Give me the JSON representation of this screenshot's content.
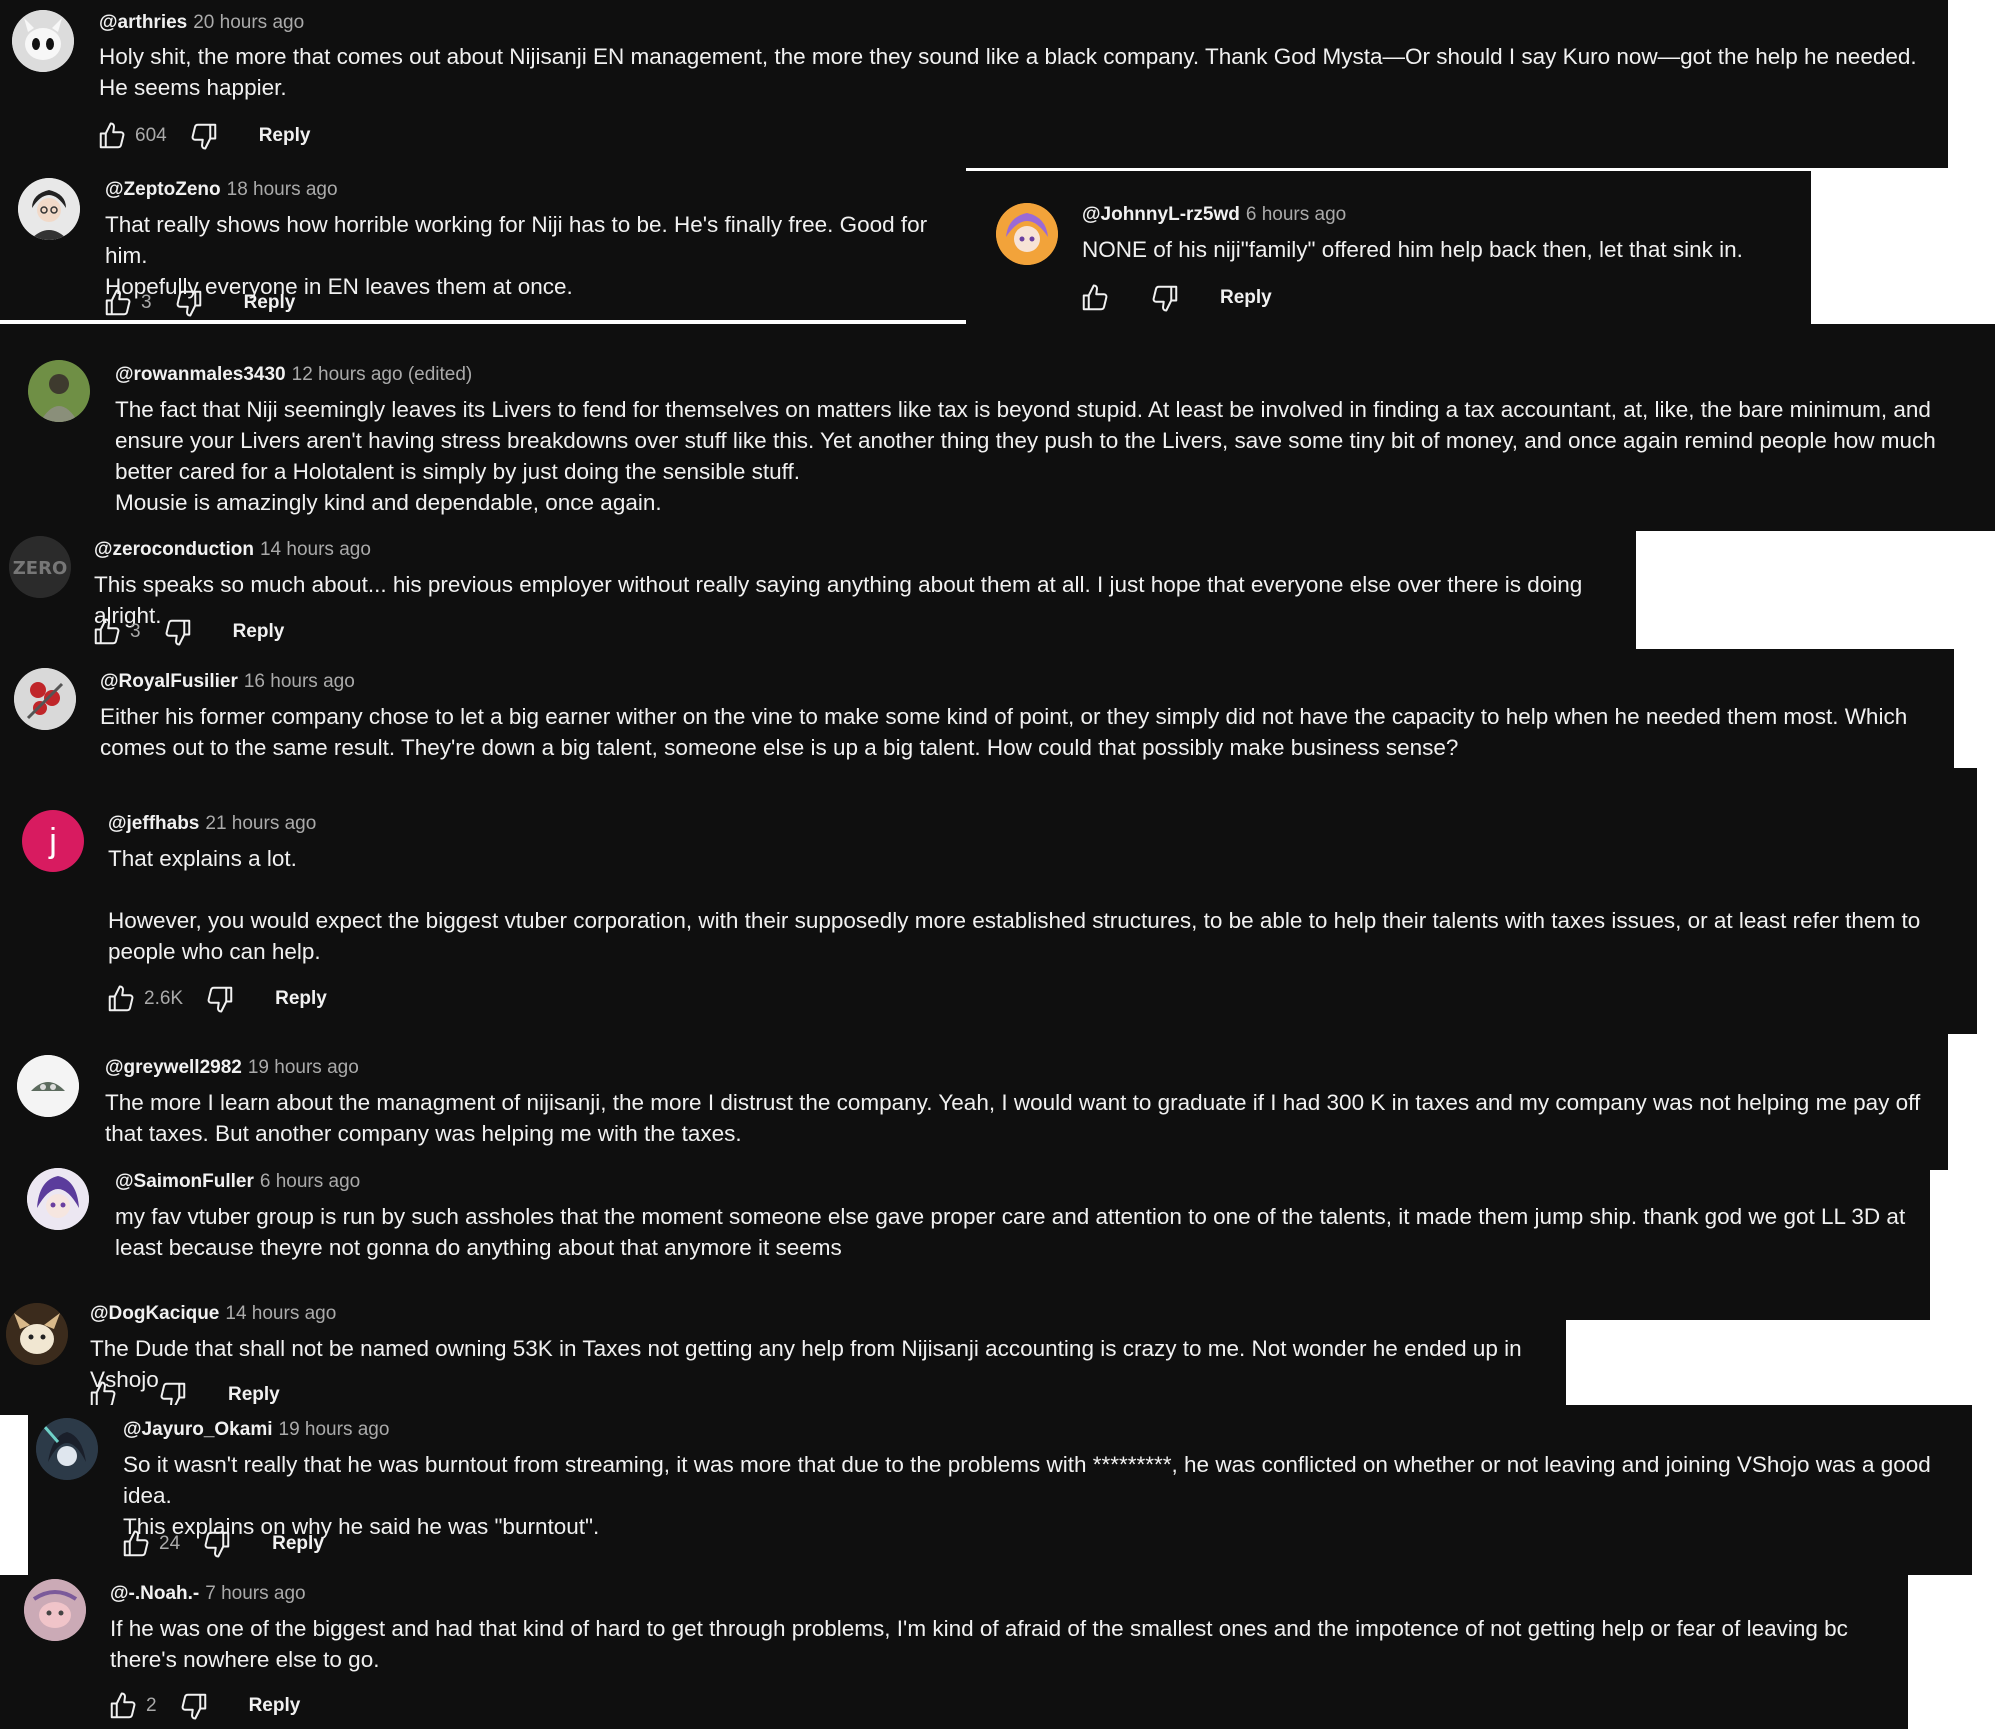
{
  "icons": {
    "like": "thumbs-up-icon",
    "dislike": "thumbs-down-icon"
  },
  "colors": {
    "background": "#0f0f0f",
    "text": "#f1f1f1",
    "meta": "#aaaaaa",
    "jeffhabs_avatar": "#d81b60"
  },
  "comments": [
    {
      "handle": "@arthries",
      "time": "20 hours ago",
      "text": "Holy shit, the more that comes out about Nijisanji EN management, the more they sound like a black company. Thank God Mysta—Or should I say Kuro now—got the help he needed. He seems happier.",
      "likes": "604",
      "reply": "Reply"
    },
    {
      "handle": "@ZeptoZeno",
      "time": "18 hours ago",
      "text": "That really shows how horrible working for Niji has to be. He's finally free. Good for him.\nHopefully everyone in EN leaves them at once.",
      "likes": "3",
      "reply": "Reply"
    },
    {
      "handle": "@JohnnyL-rz5wd",
      "time": "6 hours ago",
      "text": "NONE of his niji\"family\" offered him help back then, let that sink in.",
      "likes": "",
      "reply": "Reply"
    },
    {
      "handle": "@rowanmales3430",
      "time": "12 hours ago (edited)",
      "text": "The fact that Niji seemingly leaves its Livers to fend for themselves on matters like tax is beyond stupid. At least be involved in finding a tax accountant, at, like, the bare minimum, and ensure your Livers aren't having stress breakdowns over stuff like this. Yet another thing they push to the Livers, save some tiny bit of money, and once again remind people how much better cared for a Holotalent is simply by just doing the sensible stuff.\nMousie is amazingly kind and dependable, once again.",
      "likes": "",
      "reply": ""
    },
    {
      "handle": "@zeroconduction",
      "time": "14 hours ago",
      "text": "This speaks so much about... his previous employer without really saying anything about them at all. I just hope that everyone else over there is doing alright.",
      "likes": "3",
      "reply": "Reply"
    },
    {
      "handle": "@RoyalFusilier",
      "time": "16 hours ago",
      "text": "Either his former company chose to let a big earner wither on the vine to make some kind of point, or they simply did not have the capacity to help when he needed them most. Which comes out to the same result. They're down a big talent, someone else is up a big talent. How could that possibly make business sense?",
      "likes": "",
      "reply": ""
    },
    {
      "handle": "@jeffhabs",
      "time": "21 hours ago",
      "avatar_letter": "j",
      "text": "That explains a lot.\n\nHowever, you would expect the biggest vtuber corporation, with their supposedly more established structures, to be able to help their talents with taxes issues, or at least refer them to people who can help.",
      "likes": "2.6K",
      "reply": "Reply"
    },
    {
      "handle": "@greywell2982",
      "time": "19 hours ago",
      "text": "The more I learn about the managment of nijisanji, the more I distrust the company. Yeah, I would want to graduate if I had 300 K in taxes and my company was not helping me pay off that taxes. But another company was helping me with the taxes.",
      "likes": "",
      "reply": ""
    },
    {
      "handle": "@SaimonFuller",
      "time": "6 hours ago",
      "text": "my fav vtuber group is run by such assholes that the moment someone else gave proper care and attention to one of the talents, it made them jump ship. thank god we got LL 3D at least because theyre not gonna do anything about that anymore it seems",
      "likes": "",
      "reply": ""
    },
    {
      "handle": "@DogKacique",
      "time": "14 hours ago",
      "text": "The Dude that shall not be named owning 53K in Taxes not getting any help from Nijisanji accounting is crazy to me. Not wonder he ended up in Vshojo",
      "likes": "",
      "reply": "Reply"
    },
    {
      "handle": "@Jayuro_Okami",
      "time": "19 hours ago",
      "text": "So it wasn't really that he was burntout from streaming, it was more that due to the problems with *********, he was conflicted on whether or not leaving and joining VShojo was a good idea.\nThis explains on why he said he was \"burntout\".",
      "likes": "24",
      "reply": "Reply"
    },
    {
      "handle": "@-.Noah.-",
      "time": "7 hours ago",
      "text": "If he was one of the biggest and had that kind of hard to get through problems, I'm kind of afraid of the smallest ones and the impotence of not getting help or fear of leaving bc there's nowhere else to go.",
      "likes": "2",
      "reply": "Reply"
    }
  ]
}
